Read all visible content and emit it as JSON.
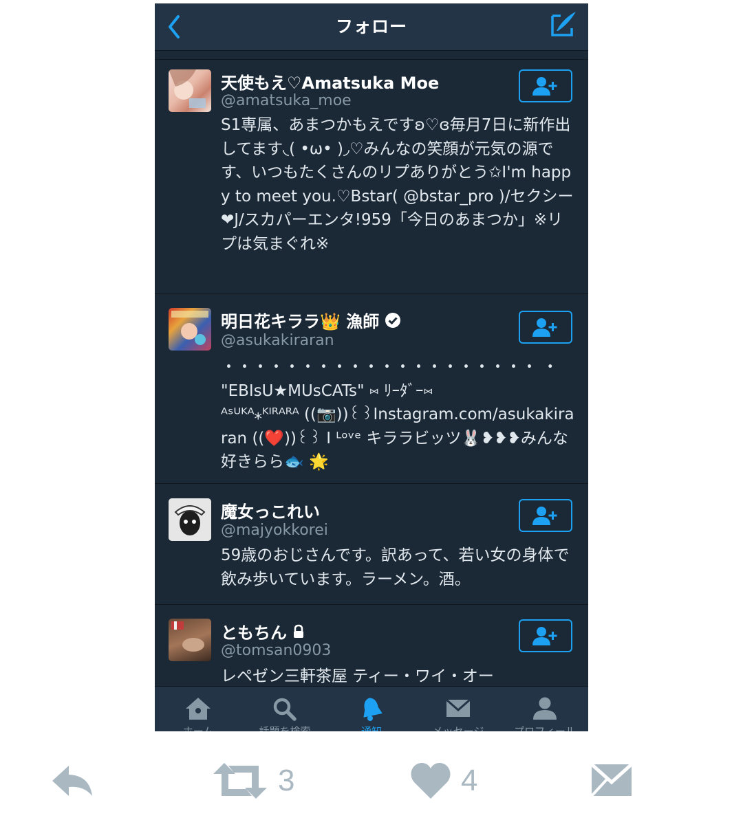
{
  "header": {
    "title": "フォロー",
    "back_icon": "chevron-left-icon",
    "compose_icon": "compose-icon"
  },
  "users": [
    {
      "name": "天使もえ♡Amatsuka Moe",
      "handle": "@amatsuka_moe",
      "bio": "S1専属、あまつかもえですʚ♡ɞ毎月7日に新作出してます◟( •ω• )◞♡みんなの笑顔が元気の源です、いつもたくさんのリプありがとう✩I'm happy to meet you.♡Bstar( @bstar_pro )/セクシー❤J/スカパーエンタ!959「今日のあまつか」※リプは気まぐれ※"
    },
    {
      "name": "明日花キララ👑 漁師",
      "handle": "@asukakiraran",
      "verified": true,
      "bio": "・・・・・・・・・・・・・・・・・・・・ ・ \"EBIsU★MUsCATs\" ⑅ ﾘｰﾀﾞｰ⑅\nᴬˢᵁᴷᴬ⁎ᴷᴵᴿᴬᴿᴬ ((📷))꒰꒱Instagram.com/asukakiraran ((❤️))꒰꒱ I ᴸᵒᵛᵉ キララビッツ🐰❥❥❥みんな好きらら🐟 🌟"
    },
    {
      "name": "魔女っこれい",
      "handle": "@majyokkorei",
      "bio": "59歳のおじさんです。訳あって、若い女の身体で飲み歩いています。ラーメン。酒。"
    },
    {
      "name": "ともちん",
      "handle": "@tomsan0903",
      "locked": true,
      "bio": "レペゼン三軒茶屋 ティー・ワイ・オー"
    }
  ],
  "tabbar": {
    "tabs": [
      {
        "label": "ホーム",
        "icon": "home-icon"
      },
      {
        "label": "話題を検索",
        "icon": "search-icon"
      },
      {
        "label": "通知",
        "icon": "bell-icon",
        "active": true
      },
      {
        "label": "メッセージ",
        "icon": "envelope-icon"
      },
      {
        "label": "プロフィール",
        "icon": "person-icon"
      }
    ]
  },
  "tweet_actions": {
    "reply_icon": "reply-icon",
    "retweet_count": "3",
    "like_count": "4",
    "dm_icon": "envelope-icon"
  },
  "colors": {
    "accent": "#1da1f2",
    "background": "#1b2836",
    "header": "#243447",
    "muted": "#8899a6",
    "action_gray": "#aab8c2"
  }
}
